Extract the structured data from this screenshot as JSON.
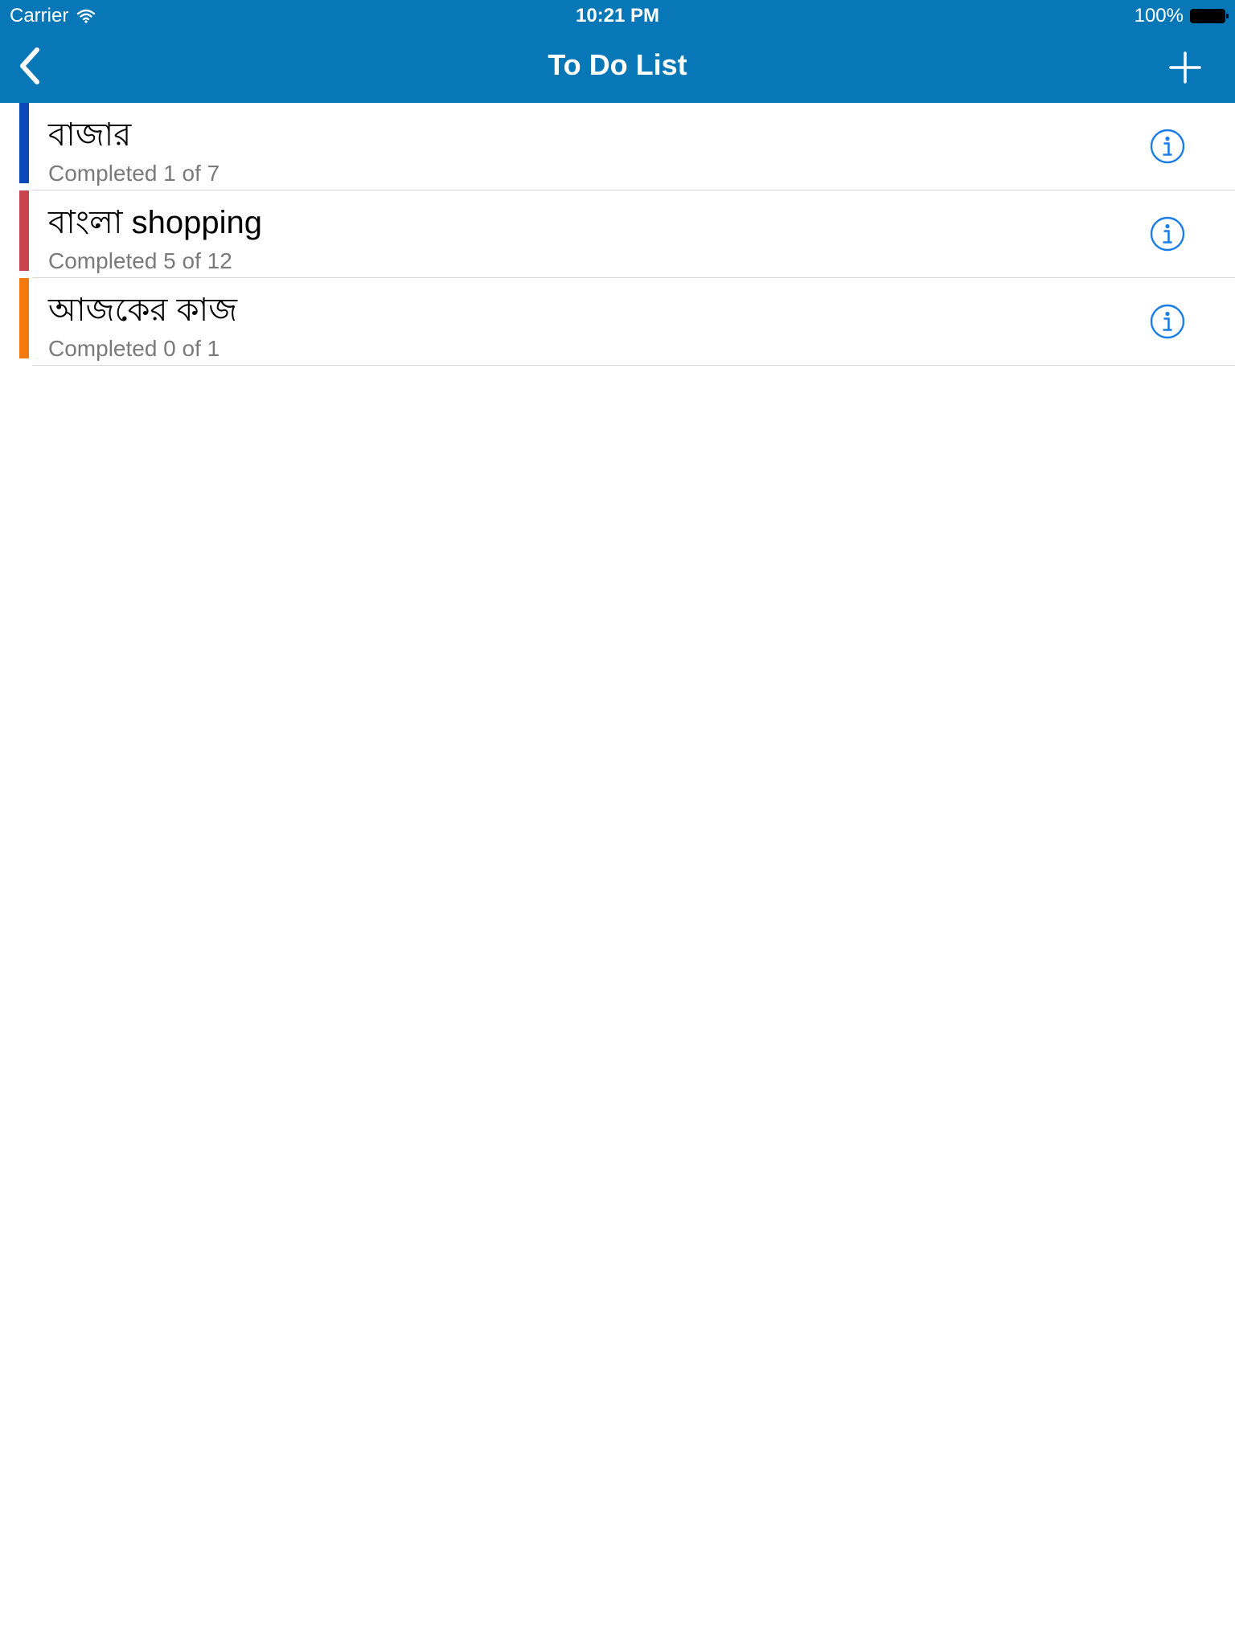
{
  "status_bar": {
    "carrier": "Carrier",
    "time": "10:21 PM",
    "battery": "100%"
  },
  "nav": {
    "title": "To Do List",
    "back_icon": "chevron-left-icon",
    "add_icon": "plus-icon"
  },
  "colors": {
    "header_bg": "#0777b8",
    "info_icon": "#1a7ee6"
  },
  "lists": [
    {
      "title": "বাজার",
      "subtitle": "Completed 1 of 7",
      "color": "#0a47b8"
    },
    {
      "title": "বাংলা shopping",
      "subtitle": "Completed 5 of 12",
      "color": "#c9444f"
    },
    {
      "title": "আজকের কাজ",
      "subtitle": "Completed 0 of 1",
      "color": "#f5790c"
    }
  ]
}
